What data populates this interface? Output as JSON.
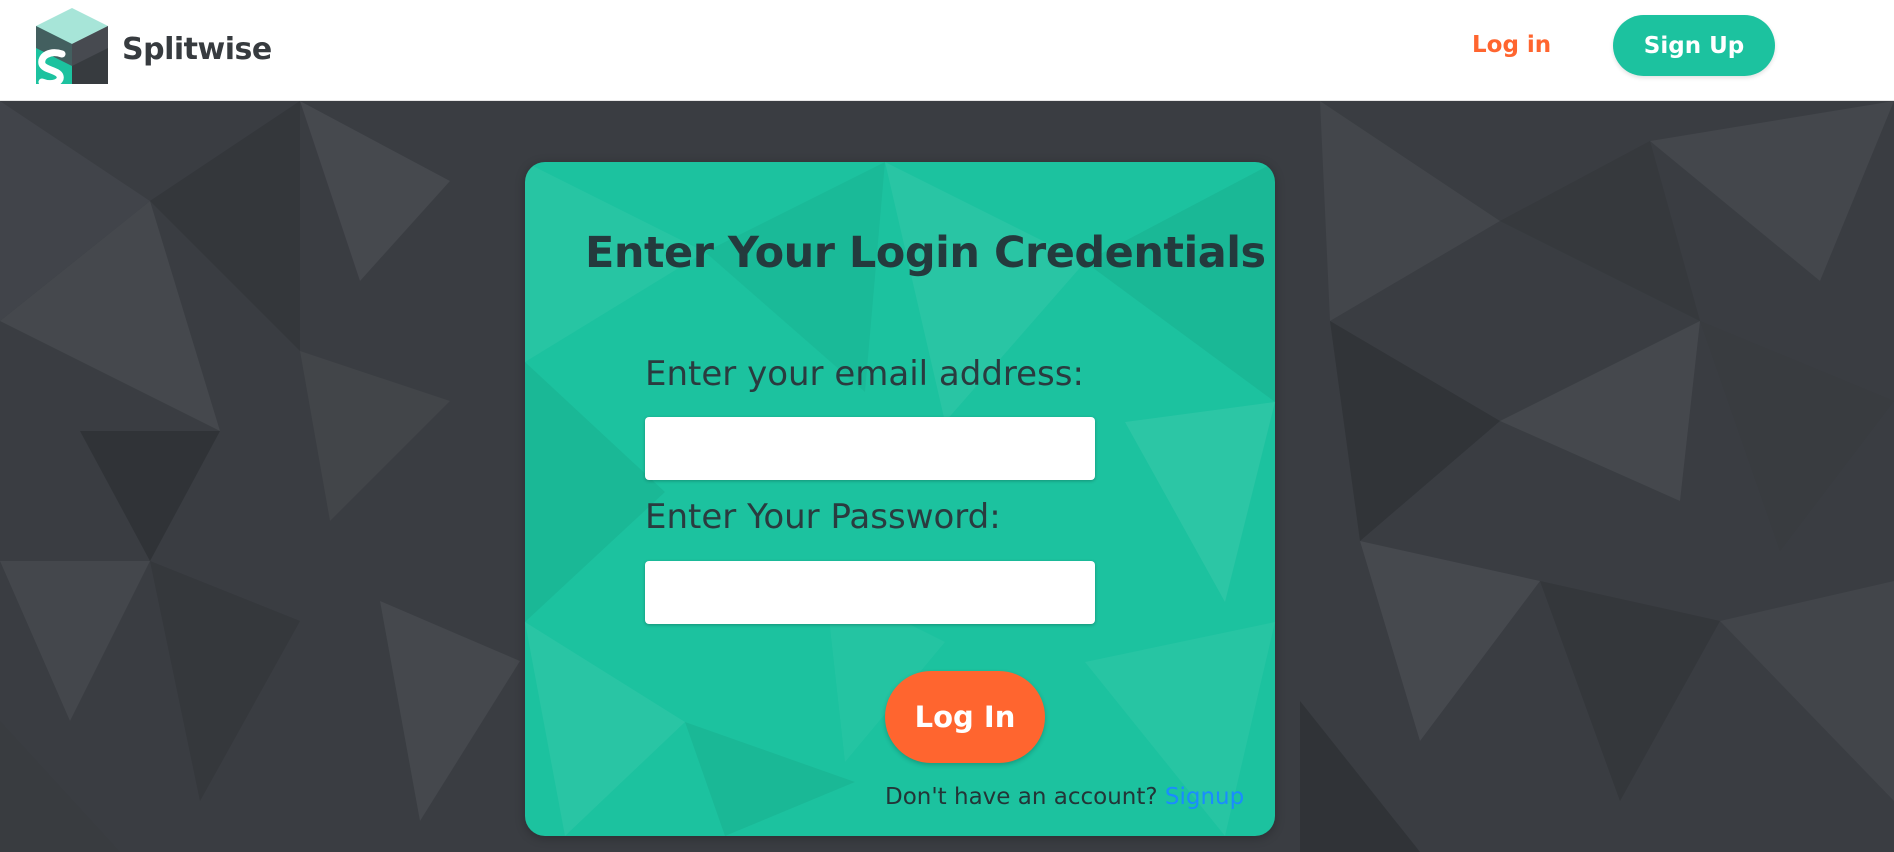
{
  "header": {
    "brand_name": "Splitwise",
    "login_label": "Log in",
    "signup_label": "Sign Up"
  },
  "login_card": {
    "title": "Enter Your Login Credentials",
    "email_label": "Enter your email address:",
    "email_value": "",
    "password_label": "Enter Your Password:",
    "password_value": "",
    "submit_label": "Log In",
    "no_account_text": "Don't have an account?",
    "signup_link_label": "Signup"
  },
  "colors": {
    "brand_teal": "#1cc29f",
    "accent_orange": "#ff652f",
    "background_dark": "#3a3d42",
    "link_blue": "#1a8cff"
  },
  "icons": {
    "logo": "splitwise-logo-icon"
  }
}
